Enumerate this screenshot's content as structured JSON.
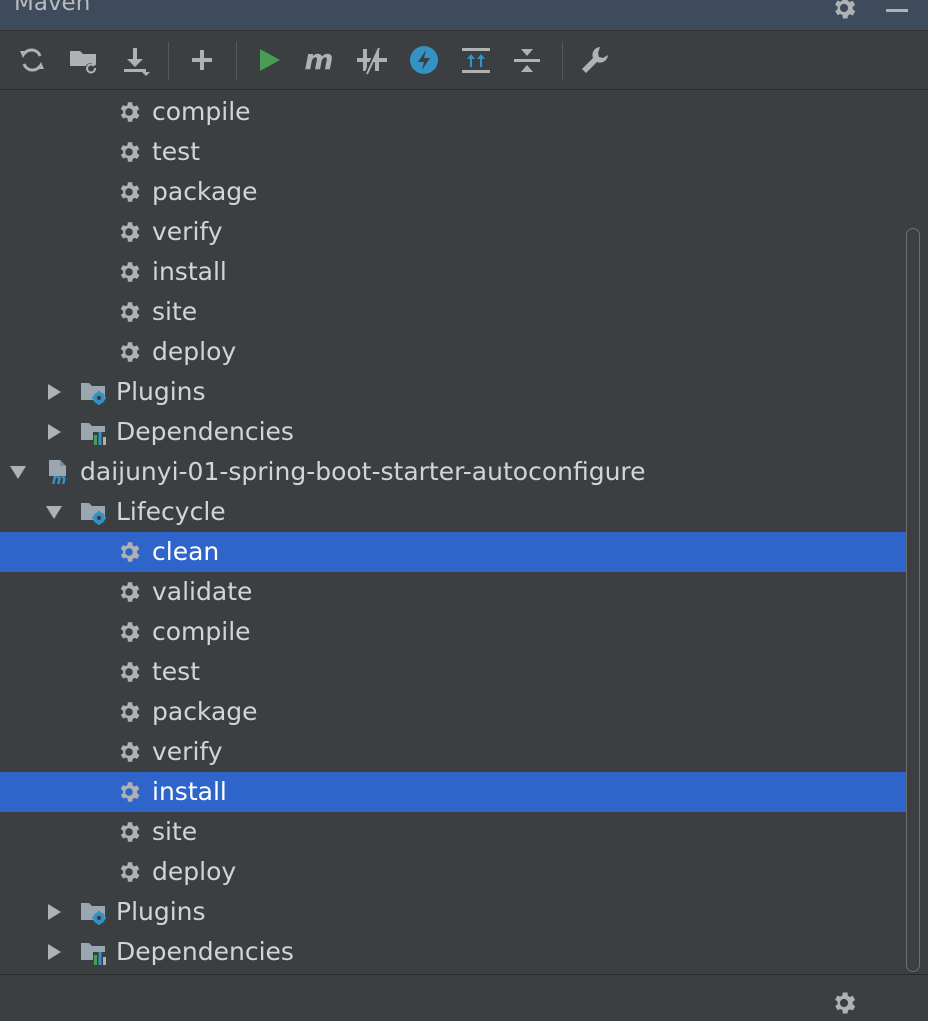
{
  "window": {
    "title": "Maven",
    "settings_icon": "gear-icon",
    "minimize_icon": "minimize-icon"
  },
  "toolbar": {
    "buttons": [
      {
        "name": "reload-all-projects-button",
        "icon": "refresh-icon"
      },
      {
        "name": "generate-sources-button",
        "icon": "folder-refresh-icon"
      },
      {
        "name": "download-sources-button",
        "icon": "download-icon"
      },
      {
        "name": "add-maven-project-button",
        "icon": "plus-icon"
      },
      {
        "name": "run-maven-build-button",
        "icon": "run-icon"
      },
      {
        "name": "execute-maven-goal-button",
        "icon": "maven-m-icon"
      },
      {
        "name": "toggle-offline-mode-button",
        "icon": "offline-icon"
      },
      {
        "name": "toggle-skip-tests-button",
        "icon": "lightning-icon"
      },
      {
        "name": "expand-all-button",
        "icon": "expand-all-icon"
      },
      {
        "name": "collapse-all-button",
        "icon": "collapse-all-icon"
      },
      {
        "name": "maven-settings-button",
        "icon": "wrench-icon"
      }
    ]
  },
  "tree": {
    "rows": [
      {
        "label": "compile",
        "type": "goal"
      },
      {
        "label": "test",
        "type": "goal"
      },
      {
        "label": "package",
        "type": "goal"
      },
      {
        "label": "verify",
        "type": "goal"
      },
      {
        "label": "install",
        "type": "goal"
      },
      {
        "label": "site",
        "type": "goal"
      },
      {
        "label": "deploy",
        "type": "goal"
      },
      {
        "label": "Plugins",
        "type": "plugins",
        "state": "collapsed"
      },
      {
        "label": "Dependencies",
        "type": "dependencies",
        "state": "collapsed"
      },
      {
        "label": "daijunyi-01-spring-boot-starter-autoconfigure",
        "type": "project",
        "state": "expanded"
      },
      {
        "label": "Lifecycle",
        "type": "lifecycle",
        "state": "expanded"
      },
      {
        "label": "clean",
        "type": "goal",
        "selected": true
      },
      {
        "label": "validate",
        "type": "goal"
      },
      {
        "label": "compile",
        "type": "goal"
      },
      {
        "label": "test",
        "type": "goal"
      },
      {
        "label": "package",
        "type": "goal"
      },
      {
        "label": "verify",
        "type": "goal"
      },
      {
        "label": "install",
        "type": "goal",
        "selected": true
      },
      {
        "label": "site",
        "type": "goal"
      },
      {
        "label": "deploy",
        "type": "goal"
      },
      {
        "label": "Plugins",
        "type": "plugins",
        "state": "collapsed"
      },
      {
        "label": "Dependencies",
        "type": "dependencies",
        "state": "collapsed"
      }
    ]
  },
  "colors": {
    "selection": "#2f65ca",
    "accent_blue": "#3592c4",
    "run_green": "#499c54",
    "icon_gray": "#afb1b3"
  }
}
